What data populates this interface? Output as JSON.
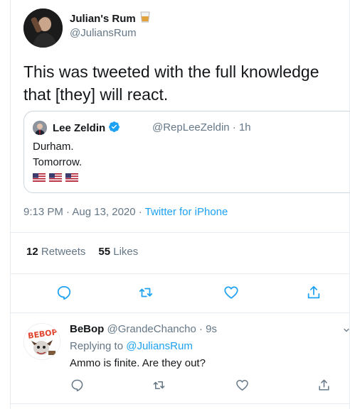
{
  "tweet": {
    "author_name": "Julian's Rum",
    "author_handle": "@JuliansRum",
    "author_badge_icon": "rum-glass-emoji",
    "text": "This was tweeted with the full knowledge that [they] will react.",
    "timestamp": "9:13 PM · Aug 13, 2020 · ",
    "source": "Twitter for iPhone",
    "retweets_count": "12",
    "retweets_label": "Retweets",
    "likes_count": "55",
    "likes_label": "Likes"
  },
  "quoted_tweet": {
    "author_name": "Lee Zeldin",
    "verified_icon": "verified-badge-icon",
    "meta": "@RepLeeZeldin · 1h",
    "line1": "Durham.",
    "line2": "Tomorrow.",
    "flags": [
      "us-flag",
      "us-flag",
      "us-flag"
    ]
  },
  "reply": {
    "author_name": "BeBop",
    "meta": "@GrandeChancho · 9s",
    "replying_prefix": "Replying to ",
    "replying_handle": "@JuliansRum",
    "text": "Ammo is finite. Are they out?"
  },
  "icons": {
    "reply": "reply-icon",
    "retweet": "retweet-icon",
    "like": "heart-icon",
    "share": "share-icon"
  },
  "colors": {
    "link": "#1da1f2",
    "muted": "#657786",
    "text": "#14171a",
    "border": "#e6ecf0"
  }
}
